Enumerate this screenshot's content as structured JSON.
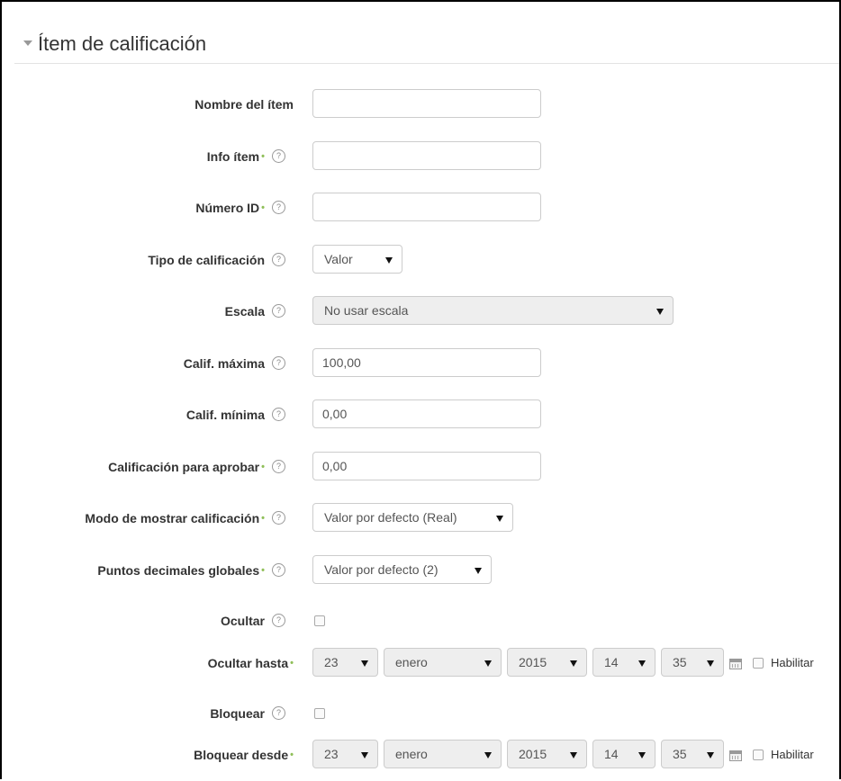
{
  "section": {
    "title": "Ítem de calificación"
  },
  "fields": {
    "item_name": {
      "label": "Nombre del ítem",
      "value": ""
    },
    "item_info": {
      "label": "Info ítem",
      "value": ""
    },
    "id_number": {
      "label": "Número ID",
      "value": ""
    },
    "grade_type": {
      "label": "Tipo de calificación",
      "value": "Valor"
    },
    "scale": {
      "label": "Escala",
      "value": "No usar escala"
    },
    "grade_max": {
      "label": "Calif. máxima",
      "value": "100,00"
    },
    "grade_min": {
      "label": "Calif. mínima",
      "value": "0,00"
    },
    "grade_pass": {
      "label": "Calificación para aprobar",
      "value": "0,00"
    },
    "display_type": {
      "label": "Modo de mostrar calificación",
      "value": "Valor por defecto (Real)"
    },
    "decimals": {
      "label": "Puntos decimales globales",
      "value": "Valor por defecto (2)"
    },
    "hidden": {
      "label": "Ocultar",
      "checked": false
    },
    "hidden_until": {
      "label": "Ocultar hasta",
      "day": "23",
      "month": "enero",
      "year": "2015",
      "hour": "14",
      "minute": "35",
      "enable_label": "Habilitar",
      "enabled": false
    },
    "locked": {
      "label": "Bloquear",
      "checked": false
    },
    "lock_after": {
      "label": "Bloquear desde",
      "day": "23",
      "month": "enero",
      "year": "2015",
      "hour": "14",
      "minute": "35",
      "enable_label": "Habilitar",
      "enabled": false
    }
  },
  "icons": {
    "help": "help-circle-icon",
    "required": "required-asterisk-icon",
    "calendar": "calendar-icon",
    "collapse": "collapse-caret-icon"
  },
  "help_glyph": "?",
  "required_glyph": "•",
  "colors": {
    "required": "#8fbf58",
    "border": "#cccccc",
    "disabled_bg": "#eeeeee"
  }
}
